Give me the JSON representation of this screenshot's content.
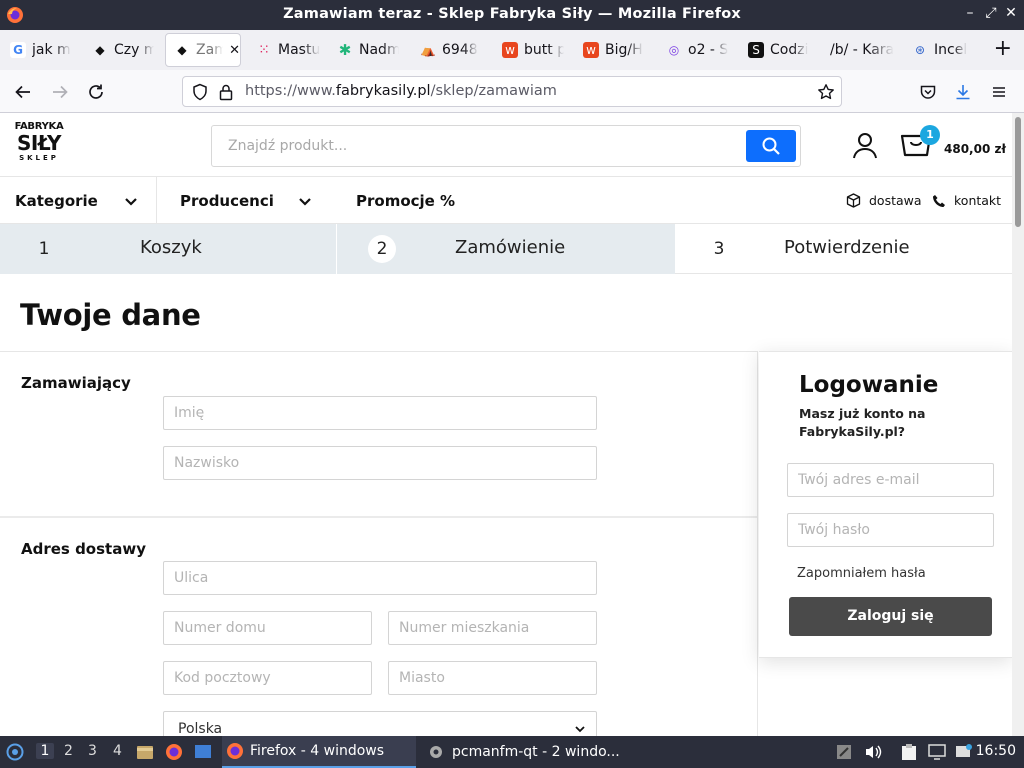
{
  "window": {
    "title": "Zamawiam teraz - Sklep Fabryka Siły — Mozilla Firefox"
  },
  "tabs": [
    {
      "label": "jak m",
      "icon": "google-icon",
      "color": "#4285f4"
    },
    {
      "label": "Czy m",
      "icon": "bird-icon",
      "color": "#111111"
    },
    {
      "label": "Zam",
      "icon": "fabryka-icon",
      "color": "#111111"
    },
    {
      "label": "Mastu",
      "icon": "grid-icon",
      "color": "#e0245e"
    },
    {
      "label": "Nadm",
      "icon": "star-icon",
      "color": "#21b57a"
    },
    {
      "label": "6948",
      "icon": "tent-icon",
      "color": "#333333"
    },
    {
      "label": "butt p",
      "icon": "wykop-icon",
      "color": "#e8461e"
    },
    {
      "label": "Big/H",
      "icon": "wykop-icon",
      "color": "#e8461e"
    },
    {
      "label": "o2 - S",
      "icon": "o2-icon",
      "color": "#7b3fe4"
    },
    {
      "label": "Codzi",
      "icon": "letter-s-icon",
      "color": "#111111"
    },
    {
      "label": "/b/ - Kara",
      "icon": "",
      "color": ""
    },
    {
      "label": "Incel",
      "icon": "wiki-icon",
      "color": "#3366cc"
    }
  ],
  "address_bar": {
    "url_prefix": "https://www.",
    "url_domain": "fabrykasily.pl",
    "url_path": "/sklep/zamawiam"
  },
  "site": {
    "logo": {
      "line1": "FABRYKA",
      "line2": "SIŁY",
      "line3": "SKLEP"
    },
    "search": {
      "placeholder": "Znajdź produkt..."
    },
    "cart": {
      "count": "1",
      "total": "480,00 zł"
    },
    "menu": {
      "categories": "Kategorie",
      "producers": "Producenci",
      "promotions": "Promocje %",
      "delivery": "dostawa",
      "contact": "kontakt"
    },
    "steps": [
      {
        "num": "1",
        "label": "Koszyk"
      },
      {
        "num": "2",
        "label": "Zamówienie"
      },
      {
        "num": "3",
        "label": "Potwierdzenie"
      }
    ],
    "page_title": "Twoje dane",
    "orderer": {
      "heading": "Zamawiający",
      "first_name": "Imię",
      "last_name": "Nazwisko"
    },
    "address": {
      "heading": "Adres dostawy",
      "street": "Ulica",
      "house_no": "Numer domu",
      "apartment_no": "Numer mieszkania",
      "postal_code": "Kod pocztowy",
      "city": "Miasto",
      "country": "Polska"
    },
    "login": {
      "heading": "Logowanie",
      "question": "Masz już konto na FabrykaSily.pl?",
      "email_placeholder": "Twój adres e-mail",
      "password_placeholder": "Twój hasło",
      "forgot": "Zapomniałem hasła",
      "button": "Zaloguj się"
    },
    "accent_color": "#0d6efd"
  },
  "taskbar": {
    "workspaces": [
      "1",
      "2",
      "3",
      "4"
    ],
    "apps": [
      {
        "label": "Firefox - 4 windows"
      },
      {
        "label": "pcmanfm-qt - 2 windo..."
      }
    ],
    "clock": "16:50"
  }
}
